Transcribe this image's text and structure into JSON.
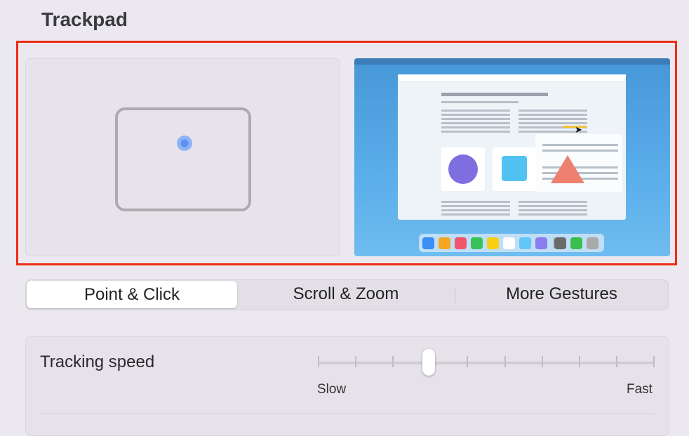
{
  "page": {
    "title": "Trackpad"
  },
  "tabs": [
    {
      "label": "Point & Click",
      "active": true
    },
    {
      "label": "Scroll & Zoom",
      "active": false
    },
    {
      "label": "More Gestures",
      "active": false
    }
  ],
  "tracking_speed": {
    "label": "Tracking speed",
    "min_label": "Slow",
    "max_label": "Fast",
    "value_fraction": 0.33,
    "tick_count": 10
  },
  "colors": {
    "highlight_border": "#ee2d14",
    "touch_dot": "#5f8fef",
    "preview_background": "#4797d6"
  },
  "dock_icon_colors": [
    "#3a8ef5",
    "#f6a623",
    "#f0566b",
    "#37c25a",
    "#f7d10f",
    "#ffffff",
    "#62c6f7",
    "#8a7df0",
    "#6a6a6a",
    "#3abf4f",
    "#aaaaaa"
  ]
}
